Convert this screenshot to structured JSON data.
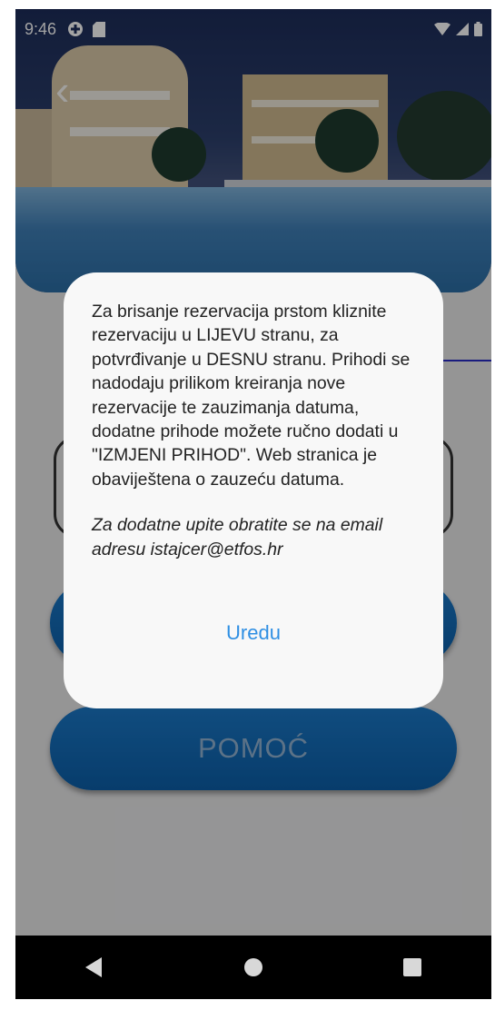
{
  "status_bar": {
    "time": "9:46"
  },
  "main": {
    "buttons": [
      {
        "label": ""
      },
      {
        "label": "POMOĆ"
      }
    ]
  },
  "dialog": {
    "message": "Za brisanje rezervacija prstom kliznite rezervaciju u LIJEVU stranu, za potvrđivanje u DESNU stranu. Prihodi se nadodaju prilikom kreiranja nove rezervacije te zauzimanja datuma, dodatne prihode možete ručno dodati u \"IZMJENI PRIHOD\". Web stranica je obaviještena o zauzeću datuma.",
    "contact": "Za dodatne upite obratite se na email adresu istajcer@etfos.hr",
    "ok_label": "Uredu"
  },
  "colors": {
    "accent": "#2f8fe3",
    "button": "#0c5fa9",
    "underline": "#2a2cc5"
  },
  "icons": [
    "data-saver-icon",
    "sd-card-icon",
    "wifi-icon",
    "signal-icon",
    "battery-icon",
    "back-arrow-icon",
    "nav-back-icon",
    "nav-home-icon",
    "nav-recents-icon"
  ]
}
